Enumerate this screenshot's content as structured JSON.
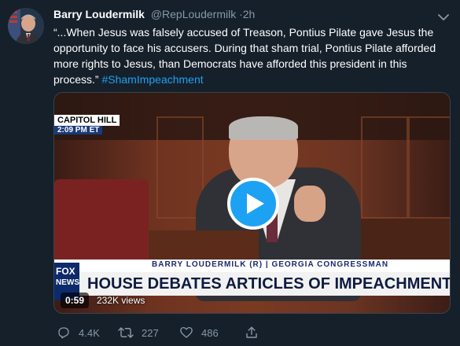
{
  "tweet": {
    "author_name": "Barry Loudermilk",
    "handle": "@RepLoudermilk",
    "separator": "·",
    "time": "2h",
    "text": "“...When Jesus was falsely accused of Treason, Pontius Pilate gave Jesus the opportunity to face his accusers. During that sham trial, Pontius Pilate afforded more rights to Jesus, than Democrats have afforded this president in this process.” ",
    "hashtag": "#ShamImpeachment"
  },
  "video": {
    "corner_tag_line1": "CAPITOL HILL",
    "corner_tag_line2": "2:09 PM ET",
    "lower_third_small": "BARRY LOUDERMILK (R) | GEORGIA CONGRESSMAN",
    "headline": "HOUSE DEBATES ARTICLES OF IMPEACHMENT",
    "network_line1": "FOX",
    "network_line2": "NEWS",
    "duration": "0:59",
    "views": "232K views"
  },
  "actions": {
    "reply_count": "4.4K",
    "retweet_count": "227",
    "like_count": "486"
  },
  "icons": {
    "menu": "chevron-down-icon",
    "play": "play-icon",
    "reply": "reply-icon",
    "retweet": "retweet-icon",
    "like": "heart-icon",
    "share": "share-icon"
  },
  "colors": {
    "background": "#15202b",
    "accent": "#1da1f2",
    "muted": "#8899a6"
  }
}
